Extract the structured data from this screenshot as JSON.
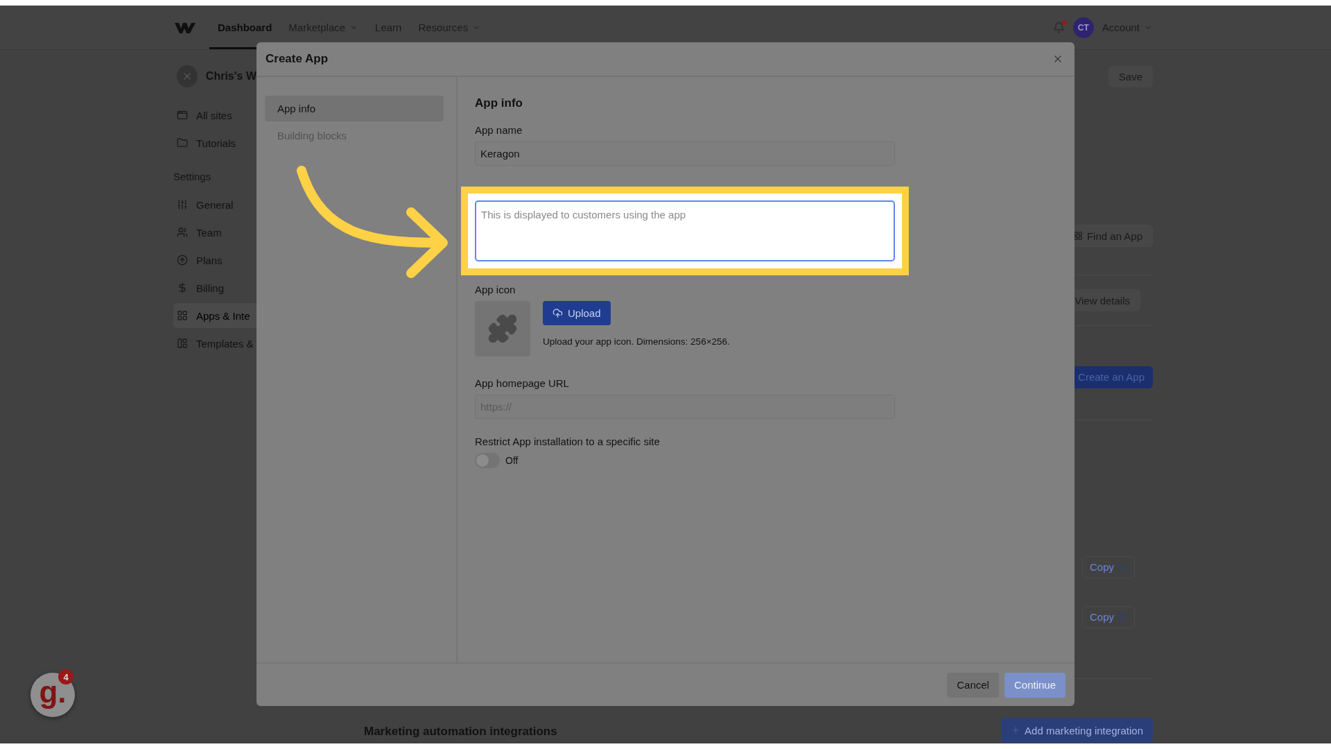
{
  "nav": {
    "items": [
      {
        "label": "Dashboard",
        "selected": true,
        "dropdown": false
      },
      {
        "label": "Marketplace",
        "selected": false,
        "dropdown": true
      },
      {
        "label": "Learn",
        "selected": false,
        "dropdown": false
      },
      {
        "label": "Resources",
        "selected": false,
        "dropdown": true
      }
    ],
    "notification_unread": true,
    "avatar": "CT",
    "account": "Account"
  },
  "sidebar": {
    "workspace": "Chris's W",
    "items": [
      {
        "label": "All sites",
        "selected": false
      },
      {
        "label": "Tutorials",
        "selected": false
      }
    ],
    "section": "Settings",
    "settings_items": [
      {
        "label": "General",
        "selected": false
      },
      {
        "label": "Team",
        "selected": false
      },
      {
        "label": "Plans",
        "selected": false
      },
      {
        "label": "Billing",
        "selected": false
      },
      {
        "label": "Apps & Inte",
        "selected": true
      },
      {
        "label": "Templates &",
        "selected": false
      }
    ]
  },
  "page": {
    "save": "Save",
    "find_app": "Find an App",
    "view_details": "View details",
    "create_app": "Create an App",
    "copy_buttons": [
      "Copy",
      "Copy"
    ],
    "section_title": "Marketing automation integrations",
    "add_integration": "Add marketing integration"
  },
  "modal": {
    "title": "Create App",
    "steps": [
      {
        "label": "App info",
        "selected": true
      },
      {
        "label": "Building blocks",
        "selected": false
      }
    ],
    "heading": "App info",
    "app_name": {
      "label": "App name",
      "value": "Keragon"
    },
    "app_description": {
      "placeholder": "This is displayed to customers using the app",
      "highlighted": true
    },
    "app_icon": {
      "label": "App icon",
      "button": "Upload",
      "hint": "Upload your app icon. Dimensions: 256×256."
    },
    "homepage": {
      "label": "App homepage URL",
      "placeholder": "https://"
    },
    "restrict": {
      "label": "Restrict App installation to a specific site",
      "on": false,
      "state": "Off"
    },
    "buttons": [
      {
        "label": "Cancel",
        "kind": "secondary",
        "disabled": false
      },
      {
        "label": "Continue",
        "kind": "primary",
        "disabled": true
      }
    ]
  },
  "guide": {
    "logo": "g.",
    "badge": "4"
  }
}
